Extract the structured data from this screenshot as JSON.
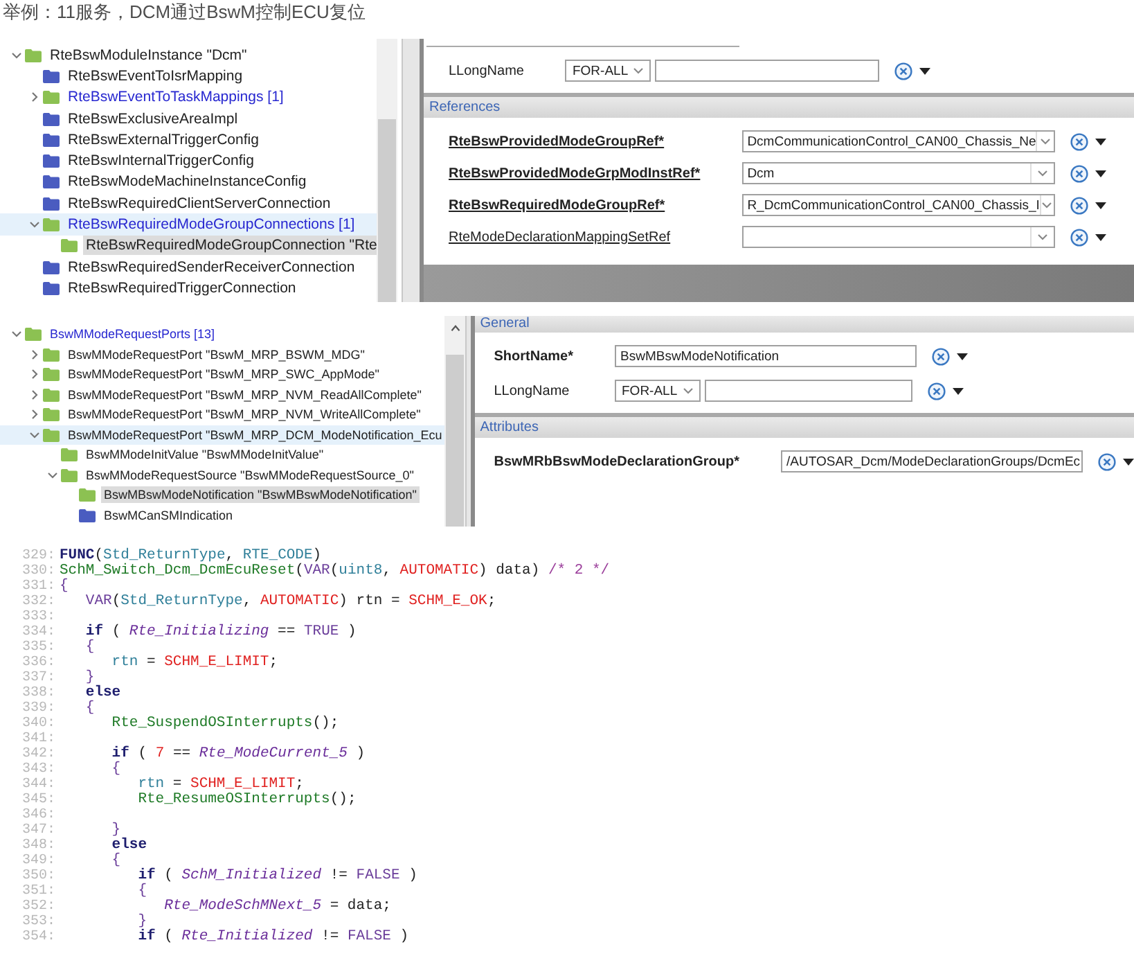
{
  "heading": "举例：11服务，DCM通过BswM控制ECU复位",
  "panels": [
    {
      "tree": [
        {
          "label": "RteBswModuleInstance \"Dcm\"",
          "kind": "item",
          "color": "#8cc152",
          "expanded": true,
          "selected": false,
          "highlighted": false,
          "children": [
            {
              "label": "RteBswEventToIsrMapping",
              "kind": "item",
              "color": "#4a5cc0",
              "selected": false,
              "highlighted": false
            },
            {
              "label": "RteBswEventToTaskMappings [1]",
              "kind": "list",
              "color": "#8cc152",
              "expanded": false,
              "selected": false,
              "highlighted": false
            },
            {
              "label": "RteBswExclusiveAreaImpl",
              "kind": "item",
              "color": "#4a5cc0",
              "selected": false,
              "highlighted": false
            },
            {
              "label": "RteBswExternalTriggerConfig",
              "kind": "item",
              "color": "#4a5cc0",
              "selected": false,
              "highlighted": false
            },
            {
              "label": "RteBswInternalTriggerConfig",
              "kind": "item",
              "color": "#4a5cc0",
              "selected": false,
              "highlighted": false
            },
            {
              "label": "RteBswModeMachineInstanceConfig",
              "kind": "item",
              "color": "#4a5cc0",
              "selected": false,
              "highlighted": false
            },
            {
              "label": "RteBswRequiredClientServerConnection",
              "kind": "item",
              "color": "#4a5cc0",
              "selected": false,
              "highlighted": false
            },
            {
              "label": "RteBswRequiredModeGroupConnections [1]",
              "kind": "list",
              "color": "#8cc152",
              "expanded": true,
              "selected": false,
              "highlighted": true,
              "children": [
                {
                  "label": "RteBswRequiredModeGroupConnection \"Rte",
                  "kind": "item",
                  "color": "#8cc152",
                  "selected": true,
                  "highlighted": false
                }
              ]
            },
            {
              "label": "RteBswRequiredSenderReceiverConnection",
              "kind": "item",
              "color": "#4a5cc0",
              "selected": false,
              "highlighted": false
            },
            {
              "label": "RteBswRequiredTriggerConnection",
              "kind": "item",
              "color": "#4a5cc0",
              "selected": false,
              "highlighted": false
            }
          ]
        }
      ],
      "form": [
        {
          "rows": [
            {
              "kind": "lang",
              "label": "LLongName",
              "required": false,
              "linked": false,
              "language": "FOR-ALL"
            }
          ]
        },
        {
          "title": "References",
          "rows": [
            {
              "kind": "combo",
              "label": "RteBswProvidedModeGroupRef*",
              "required": true,
              "linked": true,
              "value": "DcmCommunicationControl_CAN00_Chassis_Ne"
            },
            {
              "kind": "combo",
              "label": "RteBswProvidedModeGrpModInstRef*",
              "required": true,
              "linked": true,
              "value": "Dcm"
            },
            {
              "kind": "combo",
              "label": "RteBswRequiredModeGroupRef*",
              "required": true,
              "linked": true,
              "value": "R_DcmCommunicationControl_CAN00_Chassis_I"
            },
            {
              "kind": "combo",
              "label": "RteModeDeclarationMappingSetRef",
              "required": false,
              "linked": true
            }
          ]
        }
      ]
    },
    {
      "tree": [
        {
          "label": "BswMModeRequestPorts [13]",
          "kind": "list",
          "color": "#8cc152",
          "expanded": true,
          "selected": false,
          "highlighted": false,
          "children": [
            {
              "label": "BswMModeRequestPort \"BswM_MRP_BSWM_MDG\"",
              "kind": "item",
              "color": "#8cc152",
              "expanded": false,
              "selected": false,
              "highlighted": false
            },
            {
              "label": "BswMModeRequestPort \"BswM_MRP_SWC_AppMode\"",
              "kind": "item",
              "color": "#8cc152",
              "expanded": false,
              "selected": false,
              "highlighted": false
            },
            {
              "label": "BswMModeRequestPort \"BswM_MRP_NVM_ReadAllComplete\"",
              "kind": "item",
              "color": "#8cc152",
              "expanded": false,
              "selected": false,
              "highlighted": false
            },
            {
              "label": "BswMModeRequestPort \"BswM_MRP_NVM_WriteAllComplete\"",
              "kind": "item",
              "color": "#8cc152",
              "expanded": false,
              "selected": false,
              "highlighted": false
            },
            {
              "label": "BswMModeRequestPort \"BswM_MRP_DCM_ModeNotification_Ecu",
              "kind": "item",
              "color": "#8cc152",
              "expanded": true,
              "selected": false,
              "highlighted": true,
              "children": [
                {
                  "label": "BswMModeInitValue \"BswMModeInitValue\"",
                  "kind": "item",
                  "color": "#8cc152",
                  "selected": false,
                  "highlighted": false
                },
                {
                  "label": "BswMModeRequestSource \"BswMModeRequestSource_0\"",
                  "kind": "item",
                  "color": "#8cc152",
                  "expanded": true,
                  "selected": false,
                  "highlighted": false,
                  "children": [
                    {
                      "label": "BswMBswModeNotification \"BswMBswModeNotification\"",
                      "kind": "item",
                      "color": "#8cc152",
                      "selected": true,
                      "highlighted": false
                    },
                    {
                      "label": "BswMCanSMIndication",
                      "kind": "item",
                      "color": "#4a5cc0",
                      "selected": false,
                      "highlighted": false
                    }
                  ]
                }
              ]
            }
          ]
        }
      ],
      "form": [
        {
          "title": "General",
          "rows": [
            {
              "kind": "text",
              "label": "ShortName*",
              "required": true,
              "linked": false,
              "value": "BswMBswModeNotification"
            },
            {
              "kind": "lang",
              "label": "LLongName",
              "required": false,
              "linked": false,
              "language": "FOR-ALL"
            }
          ]
        },
        {
          "title": "Attributes",
          "rows": [
            {
              "kind": "text",
              "label": "BswMRbBswModeDeclarationGroup*",
              "required": true,
              "linked": false,
              "value": "/AUTOSAR_Dcm/ModeDeclarationGroups/DcmEc"
            }
          ]
        }
      ]
    }
  ],
  "code": [
    {
      "number": "329:",
      "tokens": [
        {
          "kind": "keyword",
          "text": "FUNC"
        },
        {
          "kind": "plain",
          "text": "("
        },
        {
          "kind": "ident",
          "text": "Std_ReturnType"
        },
        {
          "kind": "plain",
          "text": ", "
        },
        {
          "kind": "ident",
          "text": "RTE_CODE"
        },
        {
          "kind": "plain",
          "text": ")"
        }
      ]
    },
    {
      "number": "330:",
      "tokens": [
        {
          "kind": "func",
          "text": "SchM_Switch_Dcm_DcmEcuReset"
        },
        {
          "kind": "plain",
          "text": "("
        },
        {
          "kind": "macro",
          "text": "VAR"
        },
        {
          "kind": "plain",
          "text": "("
        },
        {
          "kind": "ident",
          "text": "uint8"
        },
        {
          "kind": "plain",
          "text": ", "
        },
        {
          "kind": "const",
          "text": "AUTOMATIC"
        },
        {
          "kind": "plain",
          "text": ") data) "
        },
        {
          "kind": "comment",
          "text": "/* 2 */"
        }
      ]
    },
    {
      "number": "331:",
      "tokens": [
        {
          "kind": "macro",
          "text": "{"
        }
      ]
    },
    {
      "number": "332:",
      "tokens": [
        {
          "kind": "macro",
          "text": "   VAR"
        },
        {
          "kind": "plain",
          "text": "("
        },
        {
          "kind": "ident",
          "text": "Std_ReturnType"
        },
        {
          "kind": "plain",
          "text": ", "
        },
        {
          "kind": "const",
          "text": "AUTOMATIC"
        },
        {
          "kind": "plain",
          "text": ") rtn = "
        },
        {
          "kind": "const",
          "text": "SCHM_E_OK"
        },
        {
          "kind": "plain",
          "text": ";"
        }
      ]
    },
    {
      "number": "333:"
    },
    {
      "number": "334:",
      "tokens": [
        {
          "kind": "keyword",
          "text": "   if"
        },
        {
          "kind": "plain",
          "text": " ( "
        },
        {
          "kind": "global",
          "text": "Rte_Initializing"
        },
        {
          "kind": "plain",
          "text": " == "
        },
        {
          "kind": "macro",
          "text": "TRUE"
        },
        {
          "kind": "plain",
          "text": " )"
        }
      ]
    },
    {
      "number": "335:",
      "tokens": [
        {
          "kind": "macro",
          "text": "   {"
        }
      ]
    },
    {
      "number": "336:",
      "tokens": [
        {
          "kind": "ident",
          "text": "      rtn"
        },
        {
          "kind": "plain",
          "text": " = "
        },
        {
          "kind": "const",
          "text": "SCHM_E_LIMIT"
        },
        {
          "kind": "plain",
          "text": ";"
        }
      ]
    },
    {
      "number": "337:",
      "tokens": [
        {
          "kind": "macro",
          "text": "   }"
        }
      ]
    },
    {
      "number": "338:",
      "tokens": [
        {
          "kind": "keyword",
          "text": "   else"
        }
      ]
    },
    {
      "number": "339:",
      "tokens": [
        {
          "kind": "macro",
          "text": "   {"
        }
      ]
    },
    {
      "number": "340:",
      "tokens": [
        {
          "kind": "func",
          "text": "      Rte_SuspendOSInterrupts"
        },
        {
          "kind": "plain",
          "text": "();"
        }
      ]
    },
    {
      "number": "341:"
    },
    {
      "number": "342:",
      "tokens": [
        {
          "kind": "keyword",
          "text": "      if"
        },
        {
          "kind": "plain",
          "text": " ( "
        },
        {
          "kind": "const",
          "text": "7"
        },
        {
          "kind": "plain",
          "text": " == "
        },
        {
          "kind": "global",
          "text": "Rte_ModeCurrent_5"
        },
        {
          "kind": "plain",
          "text": " )"
        }
      ]
    },
    {
      "number": "343:",
      "tokens": [
        {
          "kind": "macro",
          "text": "      {"
        }
      ]
    },
    {
      "number": "344:",
      "tokens": [
        {
          "kind": "ident",
          "text": "         rtn"
        },
        {
          "kind": "plain",
          "text": " = "
        },
        {
          "kind": "const",
          "text": "SCHM_E_LIMIT"
        },
        {
          "kind": "plain",
          "text": ";"
        }
      ]
    },
    {
      "number": "345:",
      "tokens": [
        {
          "kind": "func",
          "text": "         Rte_ResumeOSInterrupts"
        },
        {
          "kind": "plain",
          "text": "();"
        }
      ]
    },
    {
      "number": "346:"
    },
    {
      "number": "347:",
      "tokens": [
        {
          "kind": "macro",
          "text": "      }"
        }
      ]
    },
    {
      "number": "348:",
      "tokens": [
        {
          "kind": "keyword",
          "text": "      else"
        }
      ]
    },
    {
      "number": "349:",
      "tokens": [
        {
          "kind": "macro",
          "text": "      {"
        }
      ]
    },
    {
      "number": "350:",
      "tokens": [
        {
          "kind": "keyword",
          "text": "         if"
        },
        {
          "kind": "plain",
          "text": " ( "
        },
        {
          "kind": "global",
          "text": "SchM_Initialized"
        },
        {
          "kind": "plain",
          "text": " != "
        },
        {
          "kind": "macro",
          "text": "FALSE"
        },
        {
          "kind": "plain",
          "text": " )"
        }
      ]
    },
    {
      "number": "351:",
      "tokens": [
        {
          "kind": "macro",
          "text": "         {"
        }
      ]
    },
    {
      "number": "352:",
      "tokens": [
        {
          "kind": "global",
          "text": "            Rte_ModeSchMNext_5"
        },
        {
          "kind": "plain",
          "text": " = data;"
        }
      ]
    },
    {
      "number": "353:",
      "tokens": [
        {
          "kind": "macro",
          "text": "         }"
        }
      ]
    },
    {
      "number": "354:",
      "tokens": [
        {
          "kind": "keyword",
          "text": "         if"
        },
        {
          "kind": "plain",
          "text": " ( "
        },
        {
          "kind": "global",
          "text": "Rte_Initialized"
        },
        {
          "kind": "plain",
          "text": " != "
        },
        {
          "kind": "macro",
          "text": "FALSE"
        },
        {
          "kind": "plain",
          "text": " )"
        }
      ]
    }
  ]
}
